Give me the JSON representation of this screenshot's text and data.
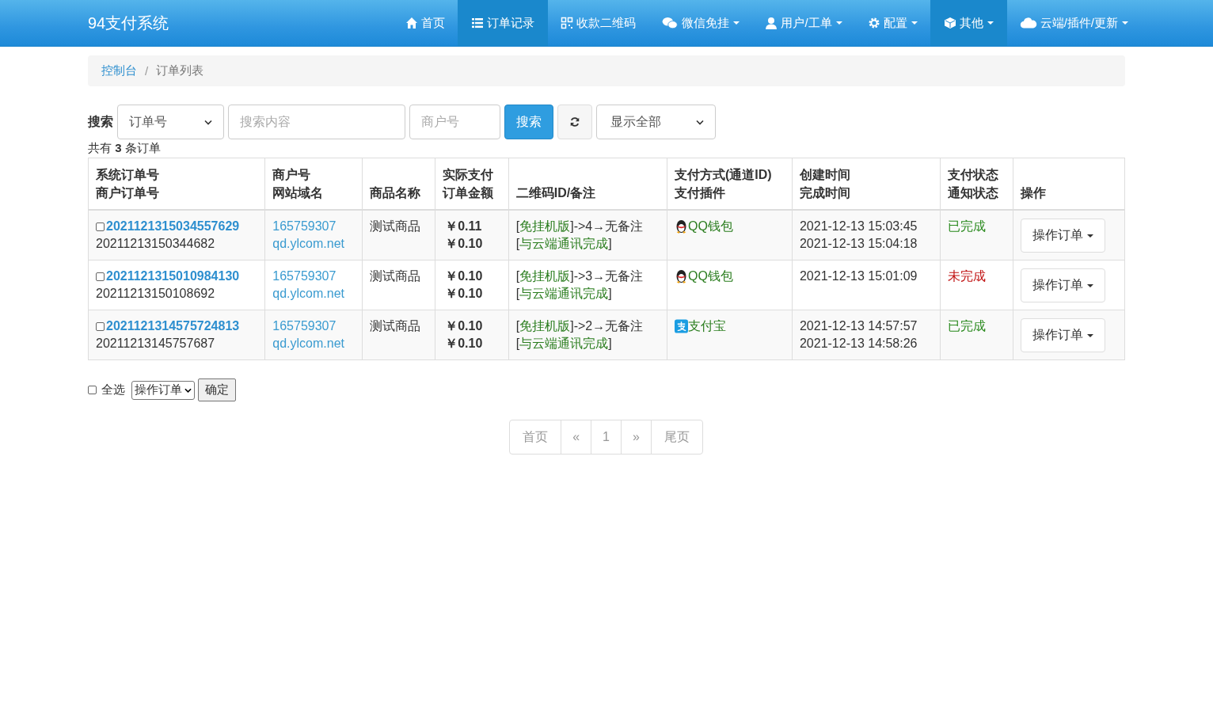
{
  "brand": "94支付系统",
  "nav": [
    {
      "kind": "home",
      "label": "首页",
      "caret": false,
      "selected": false
    },
    {
      "kind": "list",
      "label": "订单记录",
      "caret": false,
      "selected": true
    },
    {
      "kind": "qrcode",
      "label": "收款二维码",
      "caret": false,
      "selected": false
    },
    {
      "kind": "wechat",
      "label": "微信免挂",
      "caret": true,
      "selected": false
    },
    {
      "kind": "user",
      "label": "用户/工单",
      "caret": true,
      "selected": false
    },
    {
      "kind": "gear",
      "label": "配置",
      "caret": true,
      "selected": false
    },
    {
      "kind": "cube",
      "label": "其他",
      "caret": true,
      "selected": true
    },
    {
      "kind": "cloud",
      "label": "云端/插件/更新",
      "caret": true,
      "selected": false
    }
  ],
  "breadcrumb": [
    {
      "label": "控制台",
      "link": true
    },
    {
      "separator": "/",
      "label": "订单列表",
      "link": false
    }
  ],
  "search": {
    "label": "搜索",
    "field_select": "订单号",
    "query_placeholder": "搜索内容",
    "merchant_placeholder": "商户号",
    "button": "搜索",
    "filter_select": "显示全部"
  },
  "count": {
    "prefix": "共有",
    "number": "3",
    "suffix": "条订单"
  },
  "table": {
    "columns": [
      [
        "系统订单号",
        "商户订单号"
      ],
      [
        "商户号",
        "网站域名"
      ],
      [
        "商品名称"
      ],
      [
        "实际支付",
        "订单金额"
      ],
      [
        "二维码ID/备注"
      ],
      [
        "支付方式(通道ID)",
        "支付插件"
      ],
      [
        "创建时间",
        "完成时间"
      ],
      [
        "支付状态",
        "通知状态"
      ],
      [
        "操作"
      ]
    ],
    "rows": [
      {
        "checked": false,
        "sys_order": "2021121315034557629",
        "merchant_order": "20211213150344682",
        "merchant_id": "165759307",
        "domain": "qd.ylcom.net",
        "product": "测试商品",
        "paid": "￥0.11",
        "amount": "￥0.10",
        "qr": [
          [
            {
              "kind": "plain",
              "text": "["
            },
            {
              "kind": "hl",
              "text": "免挂机版"
            },
            {
              "kind": "plain",
              "text": "]->4→无备注"
            }
          ],
          [
            {
              "kind": "plain",
              "text": "["
            },
            {
              "kind": "hl",
              "text": "与云端通讯完成"
            },
            {
              "kind": "plain",
              "text": "]"
            }
          ]
        ],
        "pay": {
          "kind": "qq",
          "text": "QQ钱包"
        },
        "created": "2021-12-13 15:03:45",
        "finished": "2021-12-13 15:04:18",
        "status": {
          "kind": "done",
          "text": "已完成"
        },
        "action": "操作订单"
      },
      {
        "checked": false,
        "sys_order": "2021121315010984130",
        "merchant_order": "20211213150108692",
        "merchant_id": "165759307",
        "domain": "qd.ylcom.net",
        "product": "测试商品",
        "paid": "￥0.10",
        "amount": "￥0.10",
        "qr": [
          [
            {
              "kind": "plain",
              "text": "["
            },
            {
              "kind": "hl",
              "text": "免挂机版"
            },
            {
              "kind": "plain",
              "text": "]->3→无备注"
            }
          ],
          [
            {
              "kind": "plain",
              "text": "["
            },
            {
              "kind": "hl",
              "text": "与云端通讯完成"
            },
            {
              "kind": "plain",
              "text": "]"
            }
          ]
        ],
        "pay": {
          "kind": "qq",
          "text": "QQ钱包"
        },
        "created": "2021-12-13 15:01:09",
        "status": {
          "kind": "pending",
          "text": "未完成"
        },
        "action": "操作订单"
      },
      {
        "checked": false,
        "sys_order": "2021121314575724813",
        "merchant_order": "20211213145757687",
        "merchant_id": "165759307",
        "domain": "qd.ylcom.net",
        "product": "测试商品",
        "paid": "￥0.10",
        "amount": "￥0.10",
        "qr": [
          [
            {
              "kind": "plain",
              "text": "["
            },
            {
              "kind": "hl",
              "text": "免挂机版"
            },
            {
              "kind": "plain",
              "text": "]->2→无备注"
            }
          ],
          [
            {
              "kind": "plain",
              "text": "["
            },
            {
              "kind": "hl",
              "text": "与云端通讯完成"
            },
            {
              "kind": "plain",
              "text": "]"
            }
          ]
        ],
        "pay": {
          "kind": "alipay",
          "text": "支付宝"
        },
        "created": "2021-12-13 14:57:57",
        "finished": "2021-12-13 14:58:26",
        "status": {
          "kind": "done",
          "text": "已完成"
        },
        "action": "操作订单"
      }
    ]
  },
  "bulk": {
    "select_all": {
      "label": "全选",
      "checked": false
    },
    "action_select": "操作订单",
    "confirm": "确定"
  },
  "pagination": [
    {
      "label": "首页",
      "selected": false
    },
    {
      "label": "«",
      "selected": false
    },
    {
      "label": "1",
      "selected": false
    },
    {
      "label": "»",
      "selected": false
    },
    {
      "label": "尾页",
      "selected": false
    }
  ]
}
